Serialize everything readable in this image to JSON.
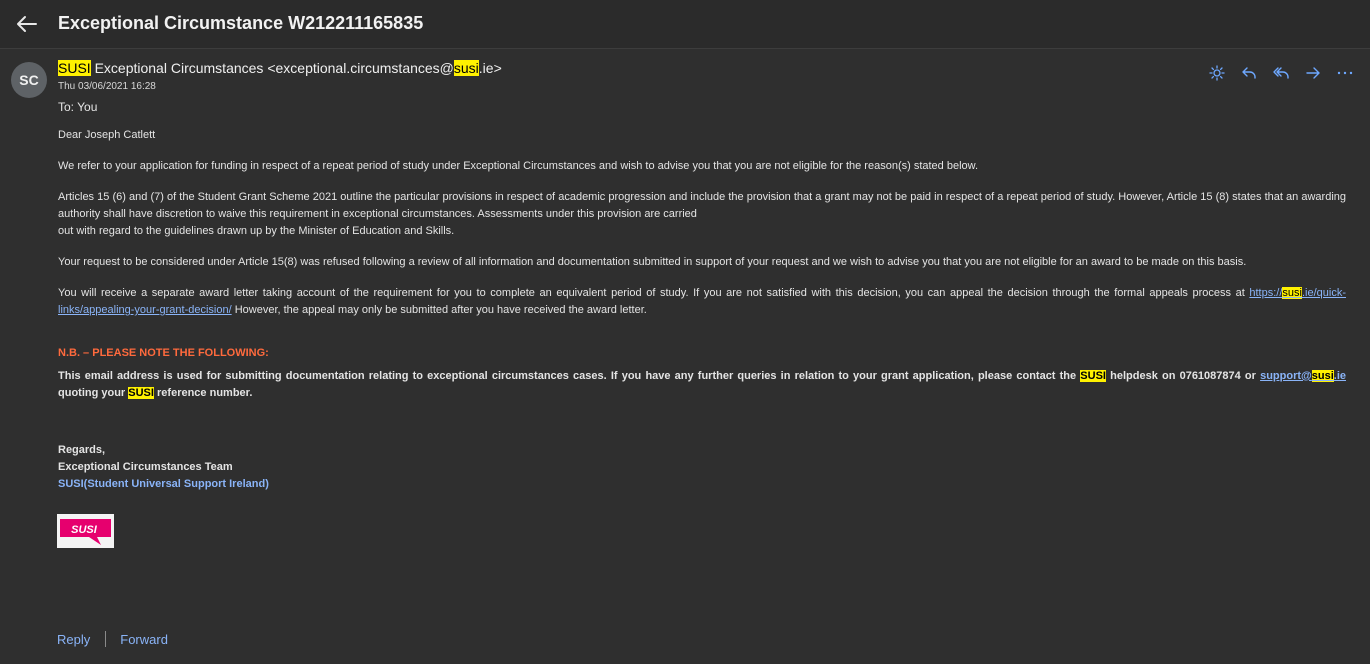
{
  "header": {
    "subject": "Exceptional Circumstance W212211165835"
  },
  "sender": {
    "avatar_initials": "SC",
    "name_highlight": "SUSI",
    "name_rest": " Exceptional Circumstances <exceptional.circumstances@",
    "email_highlight": "susi",
    "email_end": ".ie>",
    "date": "Thu 03/06/2021 16:28",
    "to": "To:  You"
  },
  "actions": {
    "icons": [
      "brightness-icon",
      "reply-icon",
      "reply-all-icon",
      "forward-icon",
      "more-icon"
    ]
  },
  "body": {
    "greeting": "Dear Joseph Catlett",
    "p1": "We refer to your application for funding in respect of a repeat period of study under Exceptional Circumstances and wish to advise you that you are not eligible for the reason(s) stated below.",
    "p2a": "Articles 15 (6) and (7) of the Student Grant Scheme 2021 outline the particular provisions in respect of academic progression and include the provision that a grant may not be paid in respect of a repeat period of study. However, Article 15 (8) states that an awarding authority shall have discretion to waive this requirement in exceptional circumstances. Assessments under this provision are carried",
    "p2b": "out with regard to the guidelines drawn up by the Minister of Education and Skills.",
    "p3": "Your request to be considered under Article 15(8) was refused following a review of all information and documentation submitted in support of your request and we wish to advise you that you are not eligible for an award to be made on this basis.",
    "p4_text": "You will receive a separate award letter taking account of the requirement for you to complete an equivalent period of study. If you are not satisfied with this decision, you can appeal the decision through the formal appeals process at ",
    "p4_link_a": "https://",
    "p4_link_hl": "susi",
    "p4_link_b": ".ie/quick-links/appealing-your-grant-decision/",
    "p4_after": " However, the appeal may only be submitted after you have received the award letter.",
    "nb": "N.B. – PLEASE NOTE THE FOLLOWING:",
    "nb_text_a": "This email address is used for submitting documentation relating to exceptional circumstances cases. If you have any further queries in relation to your grant application, please contact the ",
    "nb_hl1": "SUSI",
    "nb_text_b": " helpdesk on 0761087874 or ",
    "nb_link_a": "support@",
    "nb_link_hl": "susi",
    "nb_link_b": ".ie",
    "nb_text_c": " quoting your ",
    "nb_hl2": "SUSI",
    "nb_text_d": " reference number.",
    "regards": "Regards,",
    "team": "Exceptional Circumstances Team",
    "org": "SUSI(Student Universal Support Ireland)",
    "logo_text": "SUSI"
  },
  "footer": {
    "reply": "Reply",
    "forward": "Forward"
  },
  "colors": {
    "background": "#2f2f2f",
    "highlight": "#fff100",
    "link": "#8ab4f8",
    "nb_orange": "#ff6a3d",
    "logo_pink": "#e6006e"
  }
}
